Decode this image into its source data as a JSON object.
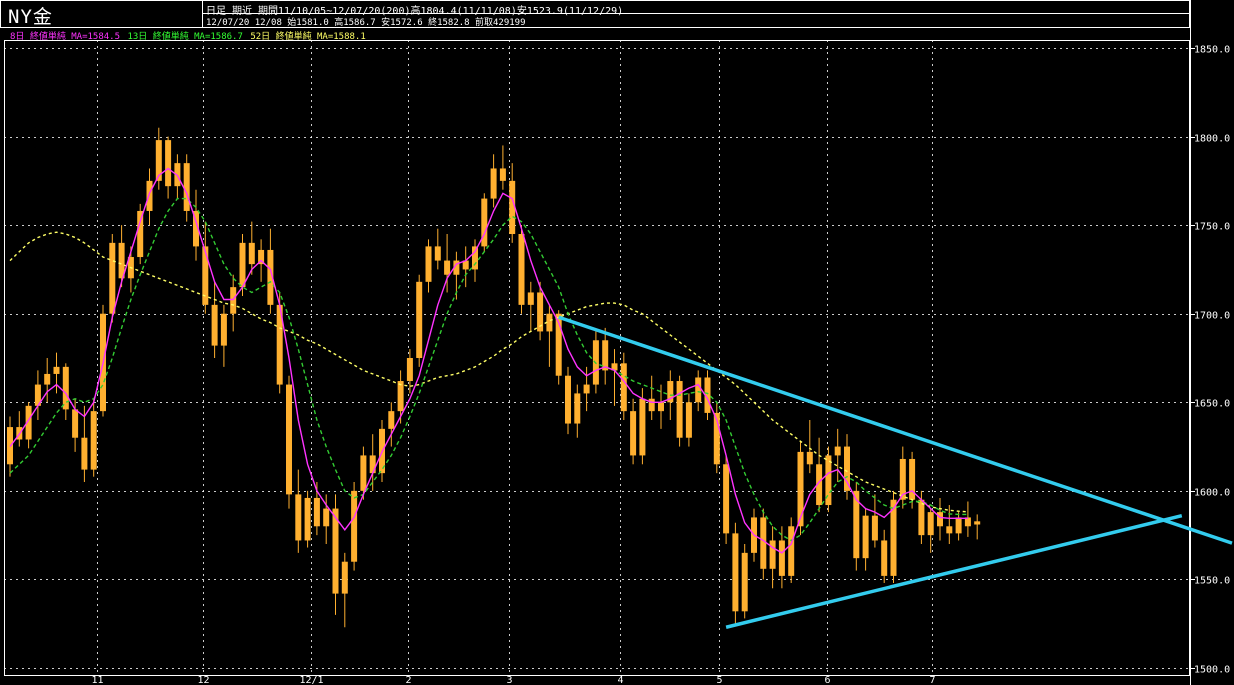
{
  "header": {
    "title": "NY金",
    "info_line1": "日足 期近 期間11/10/05~12/07/20(200)高1804.4(11/11/08)安1523.9(11/12/29)",
    "info_line2": "12/07/20 12/08 始1581.0 高1586.7 安1572.6 終1582.8 前取429199"
  },
  "legend": [
    {
      "label": "8日 終値単純 MA=1584.5",
      "color": "#ff33ff"
    },
    {
      "label": "13日 終値単純 MA=1586.7",
      "color": "#33ff33"
    },
    {
      "label": "52日 終値単純 MA=1588.1",
      "color": "#ffff66"
    }
  ],
  "chart_data": {
    "type": "candlestick",
    "y_axis": {
      "min": 1500,
      "max": 1850,
      "ticks": [
        "1850.0",
        "1800.0",
        "1750.0",
        "1700.0",
        "1650.0",
        "1600.0",
        "1550.0",
        "1500.0"
      ]
    },
    "x_tick_labels": [
      "11",
      "12",
      "12/1",
      "2",
      "3",
      "4",
      "5",
      "6",
      "7"
    ],
    "grid": true,
    "colors": {
      "background": "#000000",
      "up_candle": "#ffb030",
      "down_candle": "#ffb030",
      "grid": "#ffffff",
      "trendline": "#33ccee",
      "ma8": "#ff33ff",
      "ma13": "#33cc33",
      "ma52": "#ffff66"
    },
    "candles": [
      [
        1615,
        1642,
        1608,
        1636
      ],
      [
        1636,
        1645,
        1625,
        1629
      ],
      [
        1629,
        1650,
        1624,
        1648
      ],
      [
        1648,
        1668,
        1640,
        1660
      ],
      [
        1660,
        1675,
        1650,
        1666
      ],
      [
        1666,
        1678,
        1655,
        1670
      ],
      [
        1670,
        1672,
        1640,
        1646
      ],
      [
        1646,
        1652,
        1622,
        1630
      ],
      [
        1630,
        1648,
        1605,
        1612
      ],
      [
        1612,
        1652,
        1608,
        1645
      ],
      [
        1645,
        1705,
        1642,
        1700
      ],
      [
        1700,
        1745,
        1695,
        1740
      ],
      [
        1740,
        1750,
        1715,
        1720
      ],
      [
        1720,
        1738,
        1712,
        1732
      ],
      [
        1732,
        1762,
        1728,
        1758
      ],
      [
        1758,
        1782,
        1750,
        1775
      ],
      [
        1775,
        1805,
        1770,
        1798
      ],
      [
        1798,
        1800,
        1765,
        1772
      ],
      [
        1772,
        1790,
        1765,
        1785
      ],
      [
        1785,
        1790,
        1752,
        1758
      ],
      [
        1758,
        1770,
        1730,
        1738
      ],
      [
        1738,
        1752,
        1700,
        1705
      ],
      [
        1705,
        1718,
        1675,
        1682
      ],
      [
        1682,
        1705,
        1670,
        1700
      ],
      [
        1700,
        1722,
        1690,
        1715
      ],
      [
        1715,
        1745,
        1710,
        1740
      ],
      [
        1740,
        1752,
        1722,
        1728
      ],
      [
        1728,
        1742,
        1718,
        1736
      ],
      [
        1736,
        1748,
        1700,
        1705
      ],
      [
        1705,
        1712,
        1655,
        1660
      ],
      [
        1660,
        1665,
        1590,
        1598
      ],
      [
        1598,
        1612,
        1565,
        1572
      ],
      [
        1572,
        1600,
        1568,
        1596
      ],
      [
        1596,
        1605,
        1575,
        1580
      ],
      [
        1580,
        1598,
        1570,
        1590
      ],
      [
        1590,
        1598,
        1530,
        1542
      ],
      [
        1542,
        1565,
        1523,
        1560
      ],
      [
        1560,
        1605,
        1555,
        1600
      ],
      [
        1600,
        1625,
        1595,
        1620
      ],
      [
        1620,
        1632,
        1600,
        1610
      ],
      [
        1610,
        1640,
        1605,
        1635
      ],
      [
        1635,
        1650,
        1625,
        1645
      ],
      [
        1645,
        1668,
        1638,
        1662
      ],
      [
        1662,
        1680,
        1655,
        1675
      ],
      [
        1675,
        1722,
        1670,
        1718
      ],
      [
        1718,
        1742,
        1712,
        1738
      ],
      [
        1738,
        1748,
        1725,
        1730
      ],
      [
        1730,
        1745,
        1712,
        1722
      ],
      [
        1722,
        1735,
        1708,
        1730
      ],
      [
        1730,
        1738,
        1715,
        1725
      ],
      [
        1725,
        1742,
        1718,
        1738
      ],
      [
        1738,
        1768,
        1735,
        1765
      ],
      [
        1765,
        1790,
        1760,
        1782
      ],
      [
        1782,
        1795,
        1770,
        1775
      ],
      [
        1775,
        1785,
        1740,
        1745
      ],
      [
        1745,
        1750,
        1700,
        1705
      ],
      [
        1705,
        1718,
        1690,
        1712
      ],
      [
        1712,
        1718,
        1685,
        1690
      ],
      [
        1690,
        1705,
        1670,
        1700
      ],
      [
        1700,
        1702,
        1660,
        1665
      ],
      [
        1665,
        1670,
        1632,
        1638
      ],
      [
        1638,
        1660,
        1630,
        1655
      ],
      [
        1655,
        1670,
        1645,
        1660
      ],
      [
        1660,
        1690,
        1655,
        1685
      ],
      [
        1685,
        1692,
        1660,
        1668
      ],
      [
        1668,
        1680,
        1648,
        1672
      ],
      [
        1672,
        1678,
        1640,
        1645
      ],
      [
        1645,
        1652,
        1615,
        1620
      ],
      [
        1620,
        1658,
        1615,
        1652
      ],
      [
        1652,
        1665,
        1640,
        1645
      ],
      [
        1645,
        1660,
        1635,
        1650
      ],
      [
        1650,
        1668,
        1640,
        1662
      ],
      [
        1662,
        1665,
        1625,
        1630
      ],
      [
        1630,
        1655,
        1625,
        1650
      ],
      [
        1650,
        1668,
        1645,
        1664
      ],
      [
        1664,
        1668,
        1640,
        1644
      ],
      [
        1644,
        1650,
        1610,
        1615
      ],
      [
        1615,
        1620,
        1570,
        1576
      ],
      [
        1576,
        1582,
        1525,
        1532
      ],
      [
        1532,
        1570,
        1528,
        1565
      ],
      [
        1565,
        1590,
        1560,
        1585
      ],
      [
        1585,
        1590,
        1550,
        1556
      ],
      [
        1556,
        1580,
        1545,
        1572
      ],
      [
        1572,
        1580,
        1545,
        1552
      ],
      [
        1552,
        1585,
        1548,
        1580
      ],
      [
        1580,
        1628,
        1575,
        1622
      ],
      [
        1622,
        1640,
        1610,
        1615
      ],
      [
        1615,
        1630,
        1588,
        1592
      ],
      [
        1592,
        1625,
        1588,
        1620
      ],
      [
        1620,
        1635,
        1605,
        1625
      ],
      [
        1625,
        1632,
        1595,
        1600
      ],
      [
        1600,
        1605,
        1555,
        1562
      ],
      [
        1562,
        1590,
        1555,
        1586
      ],
      [
        1586,
        1598,
        1568,
        1572
      ],
      [
        1572,
        1578,
        1548,
        1552
      ],
      [
        1552,
        1600,
        1548,
        1595
      ],
      [
        1595,
        1625,
        1590,
        1618
      ],
      [
        1618,
        1622,
        1590,
        1595
      ],
      [
        1595,
        1600,
        1570,
        1575
      ],
      [
        1575,
        1590,
        1565,
        1588
      ],
      [
        1588,
        1596,
        1572,
        1580
      ],
      [
        1580,
        1592,
        1570,
        1576
      ],
      [
        1576,
        1588,
        1572,
        1585
      ],
      [
        1585,
        1594,
        1574,
        1580
      ],
      [
        1581.0,
        1586.7,
        1572.6,
        1582.8
      ]
    ],
    "ma8": [
      1625,
      1632,
      1640,
      1648,
      1656,
      1660,
      1655,
      1646,
      1642,
      1650,
      1672,
      1698,
      1718,
      1735,
      1752,
      1768,
      1778,
      1782,
      1778,
      1768,
      1752,
      1735,
      1718,
      1708,
      1708,
      1715,
      1725,
      1730,
      1725,
      1705,
      1675,
      1640,
      1615,
      1600,
      1592,
      1585,
      1578,
      1585,
      1598,
      1610,
      1622,
      1632,
      1642,
      1652,
      1665,
      1685,
      1705,
      1720,
      1728,
      1730,
      1735,
      1745,
      1758,
      1768,
      1765,
      1748,
      1730,
      1715,
      1705,
      1695,
      1680,
      1670,
      1665,
      1668,
      1670,
      1668,
      1662,
      1655,
      1652,
      1650,
      1650,
      1652,
      1655,
      1658,
      1660,
      1652,
      1640,
      1620,
      1598,
      1582,
      1575,
      1572,
      1568,
      1565,
      1570,
      1585,
      1598,
      1605,
      1610,
      1612,
      1605,
      1595,
      1590,
      1588,
      1585,
      1590,
      1598,
      1600,
      1595,
      1590,
      1585,
      1584.5,
      1584.5,
      1584.5
    ],
    "ma13": [
      1610,
      1615,
      1620,
      1628,
      1636,
      1644,
      1650,
      1652,
      1650,
      1652,
      1660,
      1675,
      1692,
      1708,
      1722,
      1735,
      1748,
      1758,
      1765,
      1765,
      1760,
      1752,
      1740,
      1728,
      1720,
      1715,
      1712,
      1715,
      1718,
      1712,
      1698,
      1680,
      1660,
      1640,
      1625,
      1612,
      1600,
      1596,
      1598,
      1605,
      1612,
      1620,
      1630,
      1642,
      1655,
      1670,
      1685,
      1700,
      1712,
      1722,
      1728,
      1735,
      1742,
      1750,
      1755,
      1752,
      1745,
      1735,
      1725,
      1715,
      1700,
      1688,
      1678,
      1672,
      1670,
      1668,
      1665,
      1662,
      1660,
      1658,
      1656,
      1654,
      1654,
      1655,
      1656,
      1655,
      1650,
      1640,
      1625,
      1610,
      1598,
      1588,
      1580,
      1575,
      1572,
      1575,
      1582,
      1590,
      1598,
      1605,
      1608,
      1605,
      1600,
      1596,
      1592,
      1590,
      1592,
      1594,
      1594,
      1592,
      1589,
      1587,
      1586.7,
      1586.7
    ],
    "ma52": [
      1730,
      1735,
      1740,
      1743,
      1745,
      1746,
      1745,
      1743,
      1740,
      1736,
      1732,
      1730,
      1728,
      1726,
      1724,
      1722,
      1720,
      1718,
      1716,
      1714,
      1712,
      1710,
      1708,
      1706,
      1705,
      1703,
      1700,
      1697,
      1695,
      1692,
      1690,
      1688,
      1685,
      1683,
      1680,
      1677,
      1674,
      1671,
      1668,
      1666,
      1664,
      1662,
      1660,
      1659,
      1660,
      1662,
      1664,
      1665,
      1666,
      1668,
      1670,
      1673,
      1676,
      1680,
      1683,
      1687,
      1690,
      1693,
      1696,
      1698,
      1700,
      1702,
      1704,
      1705,
      1706,
      1706,
      1705,
      1702,
      1700,
      1696,
      1692,
      1688,
      1684,
      1680,
      1676,
      1672,
      1668,
      1664,
      1660,
      1655,
      1650,
      1645,
      1640,
      1636,
      1632,
      1628,
      1624,
      1620,
      1617,
      1614,
      1611,
      1608,
      1605,
      1603,
      1601,
      1599,
      1597,
      1595,
      1593,
      1591,
      1590,
      1589,
      1588.5,
      1588.1
    ],
    "trendline_upper": {
      "from": [
        59,
        1698
      ],
      "to": [
        126,
        1580
      ]
    },
    "trendline_lower": {
      "from": [
        77,
        1523
      ],
      "to": [
        126,
        1586
      ]
    }
  }
}
